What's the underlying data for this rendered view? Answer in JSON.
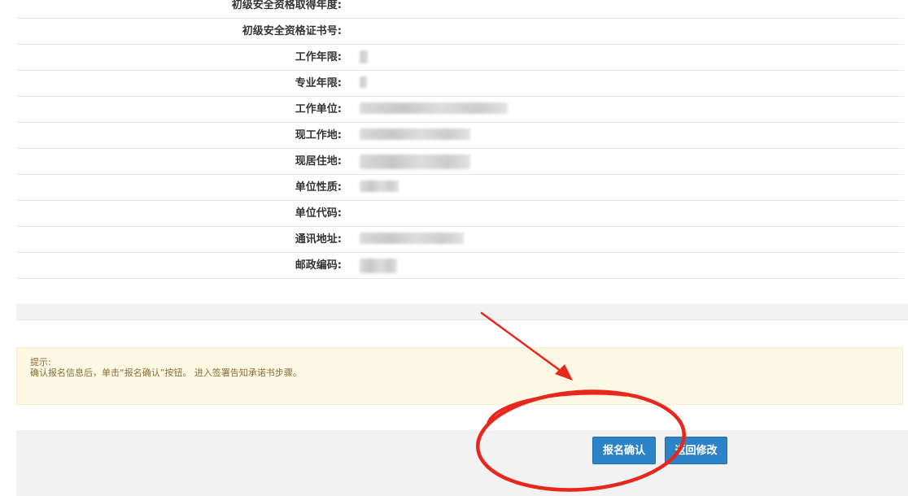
{
  "fields": [
    {
      "label": "初级安全资格取得年度:",
      "redacted": false
    },
    {
      "label": "初级安全资格证书号:",
      "redacted": false
    },
    {
      "label": "工作年限:",
      "redacted": true
    },
    {
      "label": "专业年限:",
      "redacted": true
    },
    {
      "label": "工作单位:",
      "redacted": true
    },
    {
      "label": "现工作地:",
      "redacted": true
    },
    {
      "label": "现居住地:",
      "redacted": true
    },
    {
      "label": "单位性质:",
      "redacted": true
    },
    {
      "label": "单位代码:",
      "redacted": false
    },
    {
      "label": "通讯地址:",
      "redacted": true
    },
    {
      "label": "邮政编码:",
      "redacted": true
    }
  ],
  "notice": {
    "title": "提示:",
    "text": "确认报名信息后，单击“报名确认”按钮。 进入签署告知承诺书步骤。"
  },
  "buttons": {
    "confirm": "报名确认",
    "back": "返回修改"
  },
  "colors": {
    "primary_button": "#2d83c8",
    "notice_bg": "#fcf8e3",
    "notice_text": "#8a6d3b",
    "annotation": "#e8261c"
  }
}
